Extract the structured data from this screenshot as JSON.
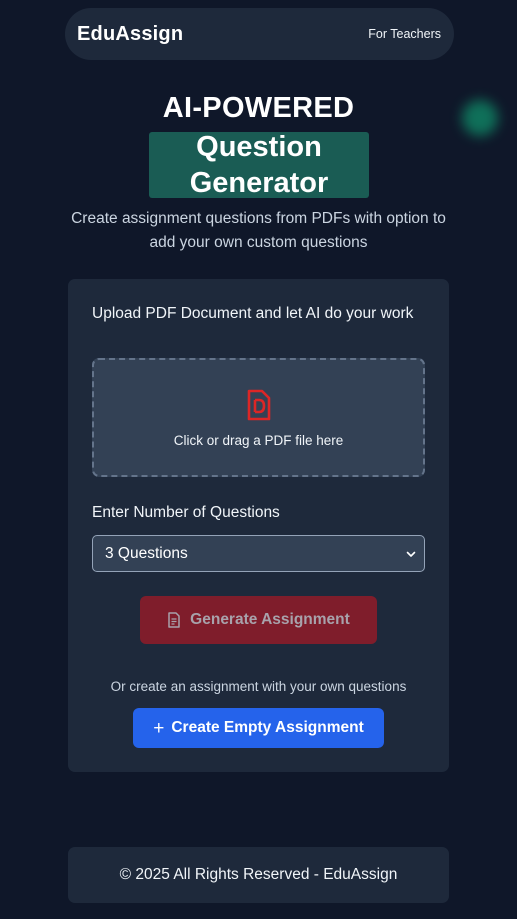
{
  "navbar": {
    "brand": "EduAssign",
    "link": "For Teachers"
  },
  "hero": {
    "title": "AI-POWERED",
    "highlight": "Question Generator",
    "subtitle": "Create assignment questions from PDFs with option to add your own custom questions"
  },
  "upload": {
    "label": "Upload PDF Document and let AI do your work",
    "dropzone_text": "Click or drag a PDF file here",
    "icon": "pdf-file-icon"
  },
  "questions": {
    "label": "Enter Number of Questions",
    "selected": "3 Questions"
  },
  "actions": {
    "generate_label": "Generate Assignment",
    "or_text": "Or create an assignment with your own questions",
    "create_empty_label": "Create Empty Assignment",
    "plus": "+"
  },
  "footer": {
    "text": "© 2025 All Rights Reserved - EduAssign"
  },
  "colors": {
    "background": "#0f1729",
    "card": "#1e293b",
    "highlight": "#1a5c54",
    "generate_button": "#7f1d2b",
    "primary_button": "#2563eb",
    "pdf_icon": "#dc2626"
  }
}
